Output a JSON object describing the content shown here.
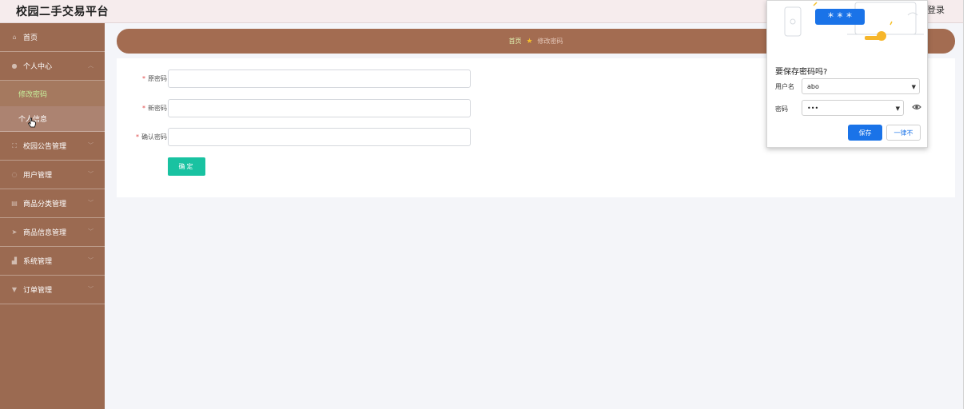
{
  "header": {
    "app_title": "校园二手交易平台",
    "login_label": "登录"
  },
  "sidebar": {
    "items": [
      {
        "label": "首页",
        "icon": "home-icon"
      },
      {
        "label": "个人中心",
        "icon": "user-icon",
        "expanded": true,
        "children": [
          {
            "label": "修改密码",
            "active": true
          },
          {
            "label": "个人信息"
          }
        ]
      },
      {
        "label": "校园公告管理",
        "icon": "expand-icon"
      },
      {
        "label": "用户管理",
        "icon": "power-icon"
      },
      {
        "label": "商品分类管理",
        "icon": "basket-icon"
      },
      {
        "label": "商品信息管理",
        "icon": "send-icon"
      },
      {
        "label": "系统管理",
        "icon": "chart-icon"
      },
      {
        "label": "订单管理",
        "icon": "cup-icon"
      }
    ]
  },
  "breadcrumb": {
    "home": "首页",
    "current": "修改密码"
  },
  "form": {
    "old_password_label": "原密码",
    "new_password_label": "新密码",
    "confirm_password_label": "确认密码",
    "submit_label": "确定"
  },
  "password_popup": {
    "title": "要保存密码吗?",
    "username_label": "用户名",
    "username_value": "abo",
    "password_label": "密码",
    "password_value": "•••",
    "save_label": "保存",
    "never_label": "一律不",
    "accent_color": "#1a73e8"
  },
  "colors": {
    "sidebar_bg": "#9b6a51",
    "breadcrumb_bg": "#a36c51",
    "confirm_button": "#19c2a1",
    "topbar_bg": "#f6eced"
  }
}
